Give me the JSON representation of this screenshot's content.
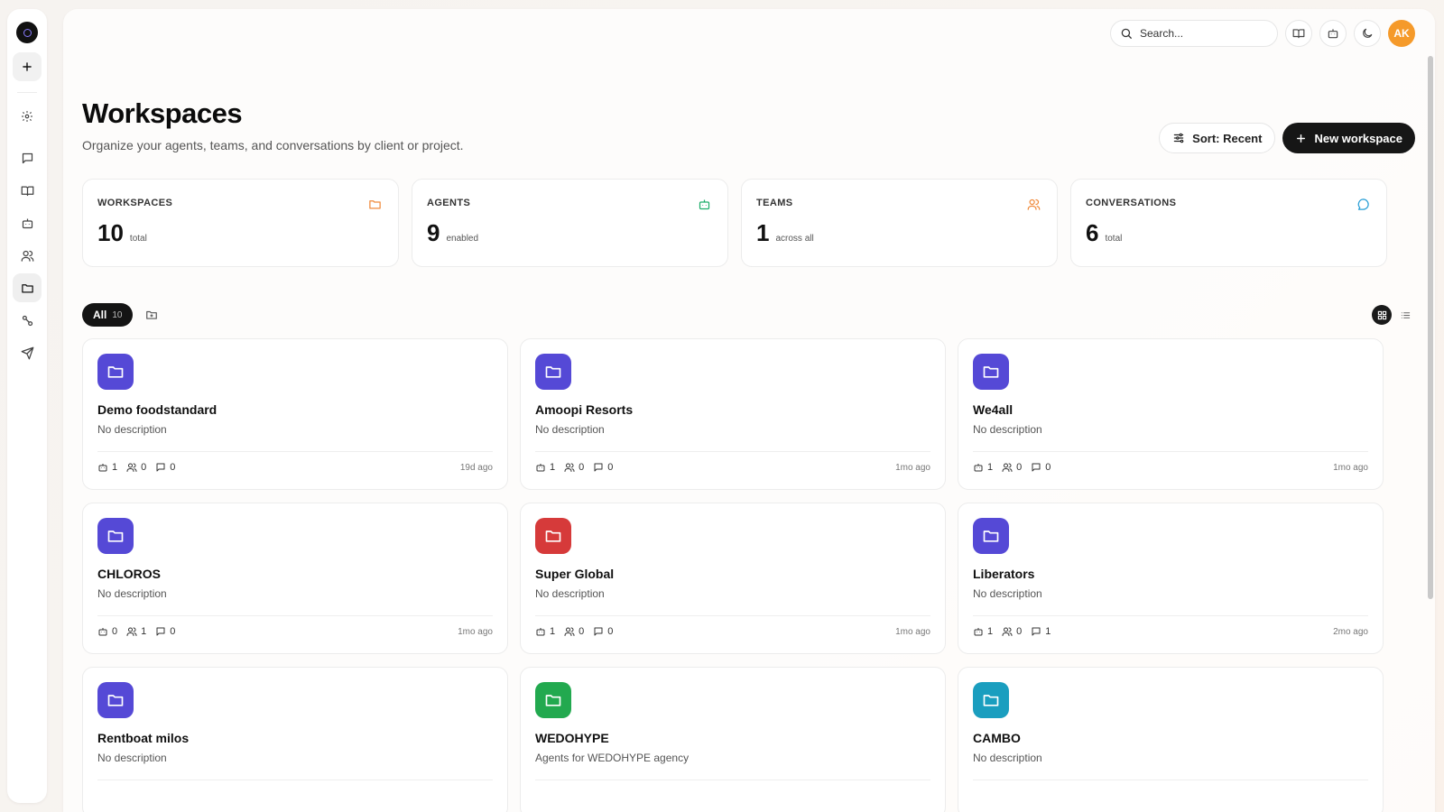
{
  "topbar": {
    "search_placeholder": "Search...",
    "avatar_initials": "AK"
  },
  "header": {
    "title": "Workspaces",
    "subtitle": "Organize your agents, teams, and conversations by client or project."
  },
  "actions": {
    "sort_label": "Sort: Recent",
    "new_label": "New workspace"
  },
  "stats": [
    {
      "label": "WORKSPACES",
      "value": "10",
      "unit": "total",
      "icon": "folder-icon",
      "color": "#f08a3c"
    },
    {
      "label": "AGENTS",
      "value": "9",
      "unit": "enabled",
      "icon": "bot-icon",
      "color": "#1fae6b"
    },
    {
      "label": "TEAMS",
      "value": "1",
      "unit": "across all",
      "icon": "users-icon",
      "color": "#f08a3c"
    },
    {
      "label": "CONVERSATIONS",
      "value": "6",
      "unit": "total",
      "icon": "chat-icon",
      "color": "#2a9fd6"
    }
  ],
  "filters": {
    "all_label": "All",
    "all_count": "10"
  },
  "workspaces": [
    {
      "name": "Demo foodstandard",
      "description": "No description",
      "agents": "1",
      "teams": "0",
      "conversations": "0",
      "updated": "19d ago",
      "color": "#5549d6"
    },
    {
      "name": "Amoopi Resorts",
      "description": "No description",
      "agents": "1",
      "teams": "0",
      "conversations": "0",
      "updated": "1mo ago",
      "color": "#5549d6"
    },
    {
      "name": "We4all",
      "description": "No description",
      "agents": "1",
      "teams": "0",
      "conversations": "0",
      "updated": "1mo ago",
      "color": "#5549d6"
    },
    {
      "name": "CHLOROS",
      "description": "No description",
      "agents": "0",
      "teams": "1",
      "conversations": "0",
      "updated": "1mo ago",
      "color": "#5549d6"
    },
    {
      "name": "Super Global",
      "description": "No description",
      "agents": "1",
      "teams": "0",
      "conversations": "0",
      "updated": "1mo ago",
      "color": "#d63a3a"
    },
    {
      "name": "Liberators",
      "description": "No description",
      "agents": "1",
      "teams": "0",
      "conversations": "1",
      "updated": "2mo ago",
      "color": "#5549d6"
    },
    {
      "name": "Rentboat milos",
      "description": "No description",
      "color": "#5549d6"
    },
    {
      "name": "WEDOHYPE",
      "description": "Agents for WEDOHYPE agency",
      "color": "#22a94f"
    },
    {
      "name": "CAMBO",
      "description": "No description",
      "color": "#1a9ebf"
    }
  ]
}
